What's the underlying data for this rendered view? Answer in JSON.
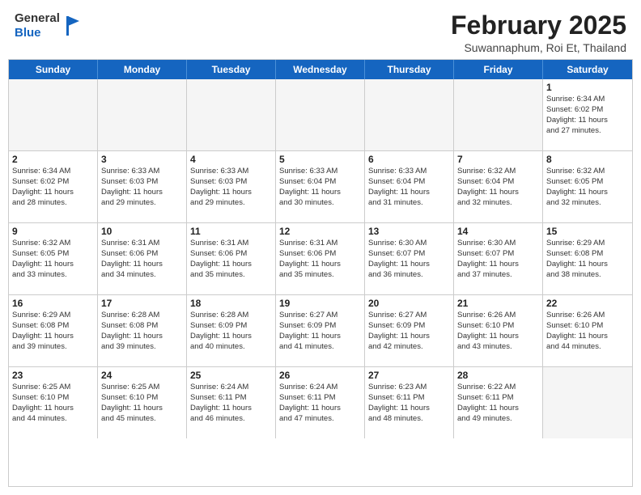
{
  "header": {
    "logo_general": "General",
    "logo_blue": "Blue",
    "month_year": "February 2025",
    "location": "Suwannaphum, Roi Et, Thailand"
  },
  "calendar": {
    "days_of_week": [
      "Sunday",
      "Monday",
      "Tuesday",
      "Wednesday",
      "Thursday",
      "Friday",
      "Saturday"
    ],
    "rows": [
      [
        {
          "day": "",
          "empty": true
        },
        {
          "day": "",
          "empty": true
        },
        {
          "day": "",
          "empty": true
        },
        {
          "day": "",
          "empty": true
        },
        {
          "day": "",
          "empty": true
        },
        {
          "day": "",
          "empty": true
        },
        {
          "day": "1",
          "info": "Sunrise: 6:34 AM\nSunset: 6:02 PM\nDaylight: 11 hours\nand 27 minutes."
        }
      ],
      [
        {
          "day": "2",
          "info": "Sunrise: 6:34 AM\nSunset: 6:02 PM\nDaylight: 11 hours\nand 28 minutes."
        },
        {
          "day": "3",
          "info": "Sunrise: 6:33 AM\nSunset: 6:03 PM\nDaylight: 11 hours\nand 29 minutes."
        },
        {
          "day": "4",
          "info": "Sunrise: 6:33 AM\nSunset: 6:03 PM\nDaylight: 11 hours\nand 29 minutes."
        },
        {
          "day": "5",
          "info": "Sunrise: 6:33 AM\nSunset: 6:04 PM\nDaylight: 11 hours\nand 30 minutes."
        },
        {
          "day": "6",
          "info": "Sunrise: 6:33 AM\nSunset: 6:04 PM\nDaylight: 11 hours\nand 31 minutes."
        },
        {
          "day": "7",
          "info": "Sunrise: 6:32 AM\nSunset: 6:04 PM\nDaylight: 11 hours\nand 32 minutes."
        },
        {
          "day": "8",
          "info": "Sunrise: 6:32 AM\nSunset: 6:05 PM\nDaylight: 11 hours\nand 32 minutes."
        }
      ],
      [
        {
          "day": "9",
          "info": "Sunrise: 6:32 AM\nSunset: 6:05 PM\nDaylight: 11 hours\nand 33 minutes."
        },
        {
          "day": "10",
          "info": "Sunrise: 6:31 AM\nSunset: 6:06 PM\nDaylight: 11 hours\nand 34 minutes."
        },
        {
          "day": "11",
          "info": "Sunrise: 6:31 AM\nSunset: 6:06 PM\nDaylight: 11 hours\nand 35 minutes."
        },
        {
          "day": "12",
          "info": "Sunrise: 6:31 AM\nSunset: 6:06 PM\nDaylight: 11 hours\nand 35 minutes."
        },
        {
          "day": "13",
          "info": "Sunrise: 6:30 AM\nSunset: 6:07 PM\nDaylight: 11 hours\nand 36 minutes."
        },
        {
          "day": "14",
          "info": "Sunrise: 6:30 AM\nSunset: 6:07 PM\nDaylight: 11 hours\nand 37 minutes."
        },
        {
          "day": "15",
          "info": "Sunrise: 6:29 AM\nSunset: 6:08 PM\nDaylight: 11 hours\nand 38 minutes."
        }
      ],
      [
        {
          "day": "16",
          "info": "Sunrise: 6:29 AM\nSunset: 6:08 PM\nDaylight: 11 hours\nand 39 minutes."
        },
        {
          "day": "17",
          "info": "Sunrise: 6:28 AM\nSunset: 6:08 PM\nDaylight: 11 hours\nand 39 minutes."
        },
        {
          "day": "18",
          "info": "Sunrise: 6:28 AM\nSunset: 6:09 PM\nDaylight: 11 hours\nand 40 minutes."
        },
        {
          "day": "19",
          "info": "Sunrise: 6:27 AM\nSunset: 6:09 PM\nDaylight: 11 hours\nand 41 minutes."
        },
        {
          "day": "20",
          "info": "Sunrise: 6:27 AM\nSunset: 6:09 PM\nDaylight: 11 hours\nand 42 minutes."
        },
        {
          "day": "21",
          "info": "Sunrise: 6:26 AM\nSunset: 6:10 PM\nDaylight: 11 hours\nand 43 minutes."
        },
        {
          "day": "22",
          "info": "Sunrise: 6:26 AM\nSunset: 6:10 PM\nDaylight: 11 hours\nand 44 minutes."
        }
      ],
      [
        {
          "day": "23",
          "info": "Sunrise: 6:25 AM\nSunset: 6:10 PM\nDaylight: 11 hours\nand 44 minutes."
        },
        {
          "day": "24",
          "info": "Sunrise: 6:25 AM\nSunset: 6:10 PM\nDaylight: 11 hours\nand 45 minutes."
        },
        {
          "day": "25",
          "info": "Sunrise: 6:24 AM\nSunset: 6:11 PM\nDaylight: 11 hours\nand 46 minutes."
        },
        {
          "day": "26",
          "info": "Sunrise: 6:24 AM\nSunset: 6:11 PM\nDaylight: 11 hours\nand 47 minutes."
        },
        {
          "day": "27",
          "info": "Sunrise: 6:23 AM\nSunset: 6:11 PM\nDaylight: 11 hours\nand 48 minutes."
        },
        {
          "day": "28",
          "info": "Sunrise: 6:22 AM\nSunset: 6:11 PM\nDaylight: 11 hours\nand 49 minutes."
        },
        {
          "day": "",
          "empty": true
        }
      ]
    ]
  }
}
